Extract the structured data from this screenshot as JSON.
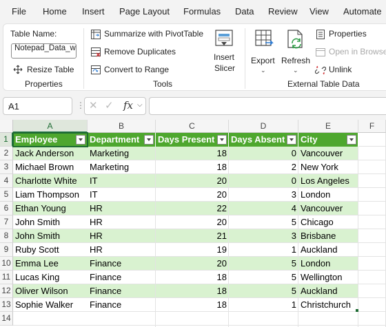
{
  "menu": [
    "File",
    "Home",
    "Insert",
    "Page Layout",
    "Formulas",
    "Data",
    "Review",
    "View",
    "Automate"
  ],
  "ribbon": {
    "table_name_label": "Table Name:",
    "table_name_value": "Notepad_Data_w",
    "resize_table": "Resize Table",
    "properties_group": "Properties",
    "summarize_pivot": "Summarize with PivotTable",
    "remove_duplicates": "Remove Duplicates",
    "convert_to_range": "Convert to Range",
    "tools_group": "Tools",
    "insert_slicer_line1": "Insert",
    "insert_slicer_line2": "Slicer",
    "export": "Export",
    "refresh": "Refresh",
    "properties_btn": "Properties",
    "open_in_browser": "Open in Browser",
    "unlink": "Unlink",
    "external_group": "External Table Data"
  },
  "formula_bar": {
    "name_box": "A1",
    "fx": "fx",
    "formula": ""
  },
  "grid": {
    "columns": [
      "A",
      "B",
      "C",
      "D",
      "E",
      "F"
    ],
    "rows": [
      "1",
      "2",
      "3",
      "4",
      "5",
      "6",
      "7",
      "8",
      "9",
      "10",
      "11",
      "12",
      "13",
      "14"
    ],
    "headers": [
      "Employee",
      "Department",
      "Days Present",
      "Days Absent",
      "City"
    ],
    "data": [
      [
        "Jack Anderson",
        "Marketing",
        "18",
        "0",
        "Vancouver"
      ],
      [
        "Michael Brown",
        "Marketing",
        "18",
        "2",
        "New York"
      ],
      [
        "Charlotte White",
        "IT",
        "20",
        "0",
        "Los Angeles"
      ],
      [
        "Liam Thompson",
        "IT",
        "20",
        "3",
        "London"
      ],
      [
        "Ethan Young",
        "HR",
        "22",
        "4",
        "Vancouver"
      ],
      [
        "John Smith",
        "HR",
        "20",
        "5",
        "Chicago"
      ],
      [
        "John Smith",
        "HR",
        "21",
        "3",
        "Brisbane"
      ],
      [
        "Ruby Scott",
        "HR",
        "19",
        "1",
        "Auckland"
      ],
      [
        "Emma Lee",
        "Finance",
        "20",
        "5",
        "London"
      ],
      [
        "Lucas King",
        "Finance",
        "18",
        "5",
        "Wellington"
      ],
      [
        "Oliver Wilson",
        "Finance",
        "18",
        "5",
        "Auckland"
      ],
      [
        "Sophie Walker",
        "Finance",
        "18",
        "1",
        "Christchurch"
      ]
    ]
  },
  "colors": {
    "table_header": "#4ea72e",
    "band": "#d9f2d0",
    "accent": "#217346"
  }
}
